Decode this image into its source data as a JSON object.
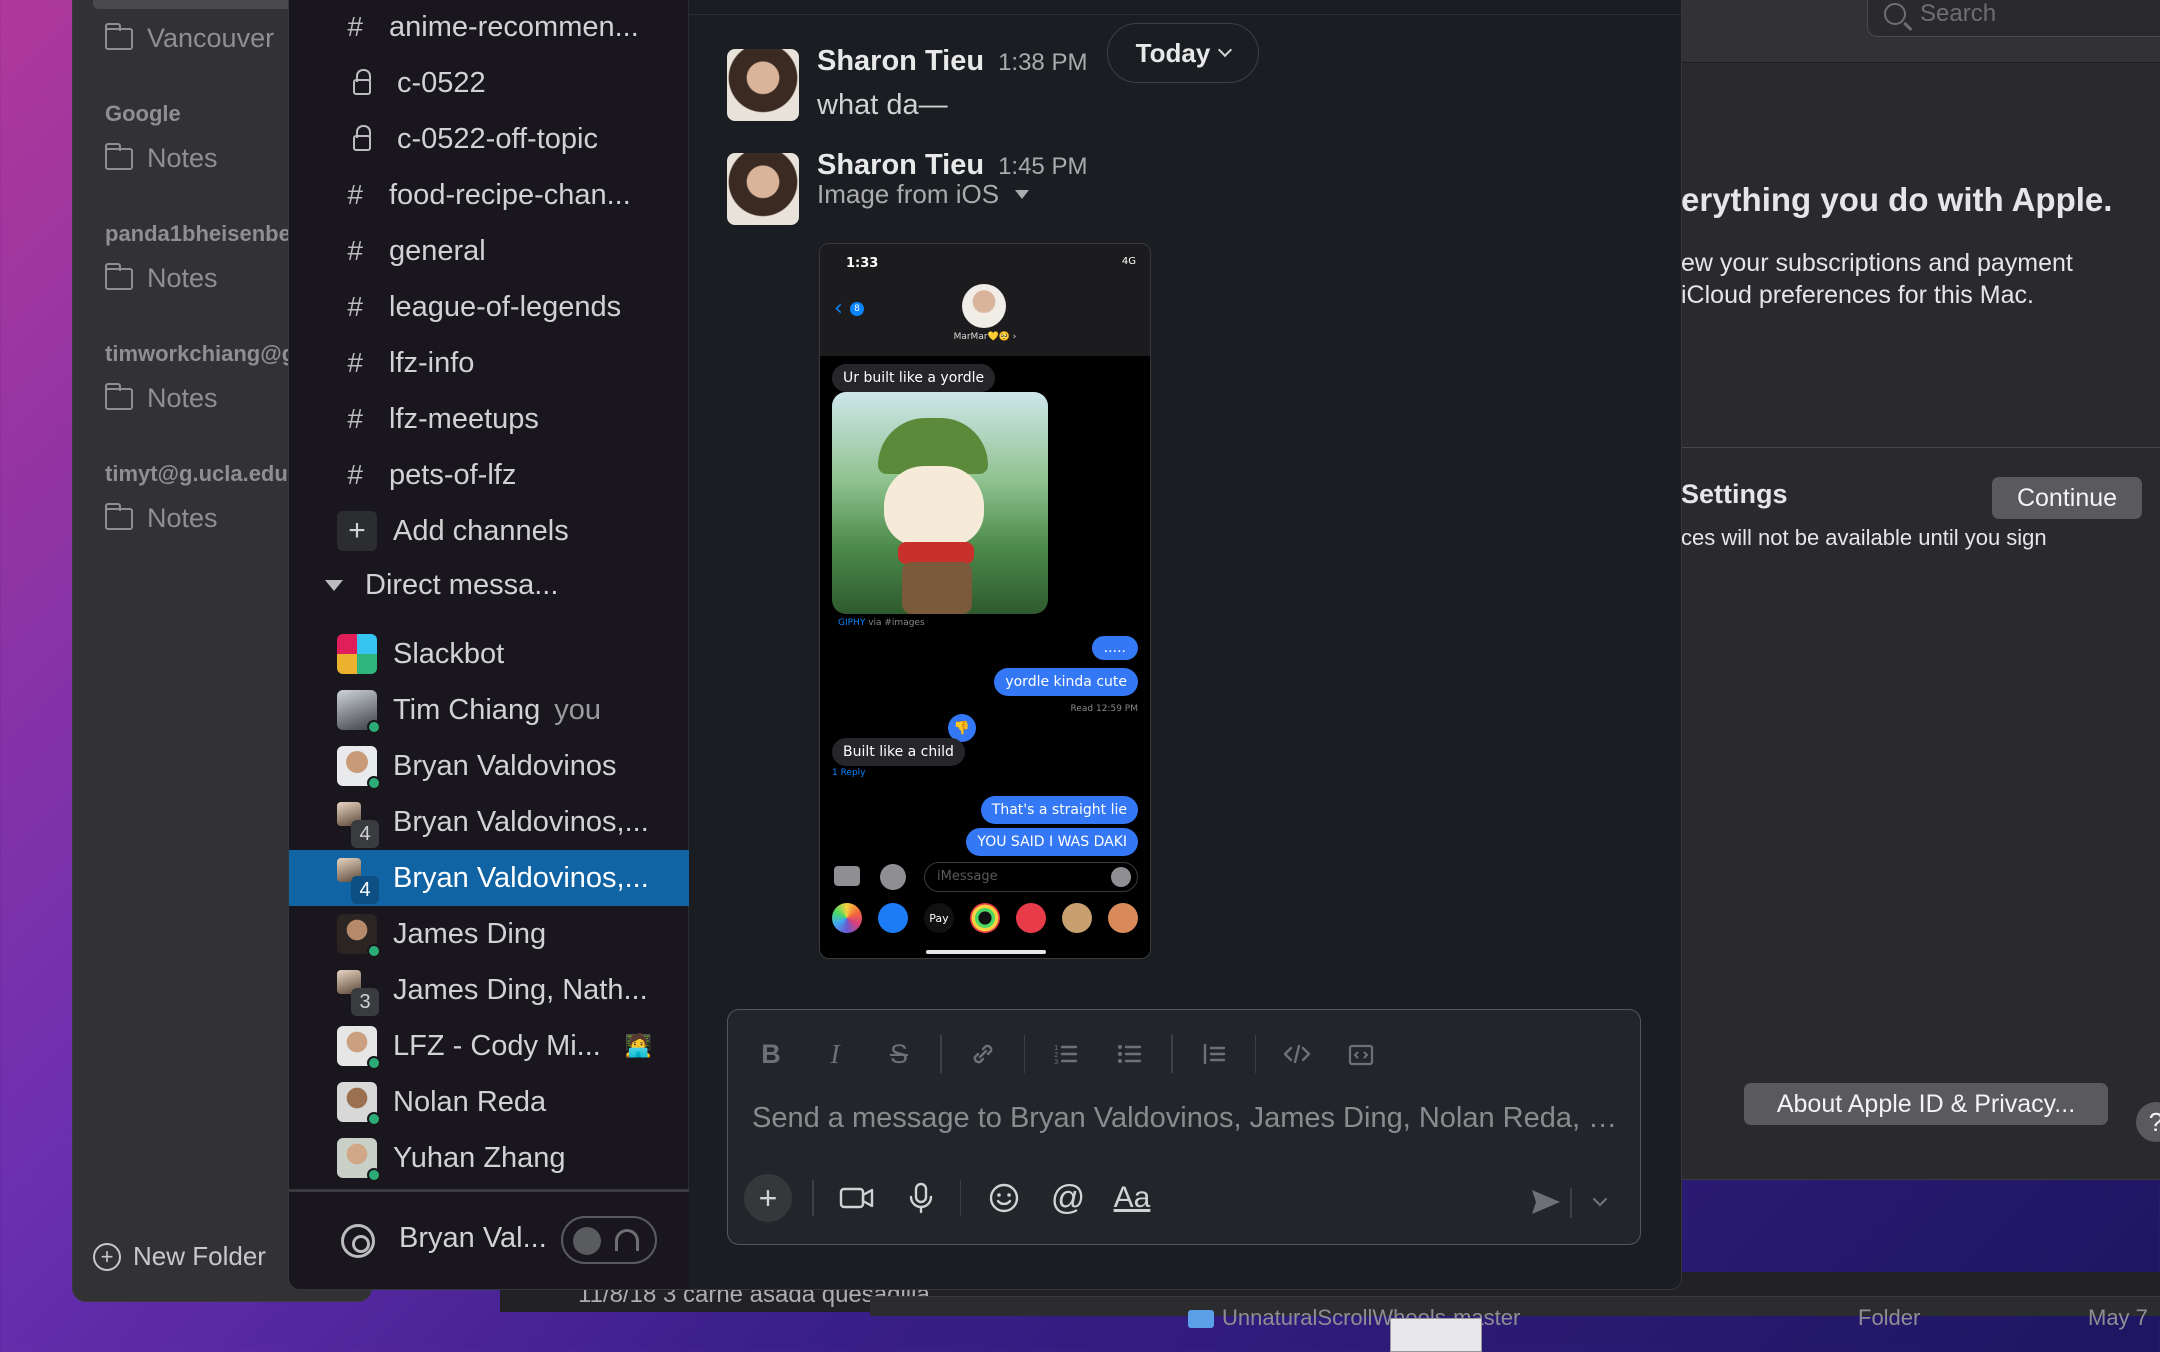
{
  "notes": {
    "accounts": [
      {
        "name": "",
        "folder": "Vancouver"
      },
      {
        "name": "Google",
        "folder": "Notes"
      },
      {
        "name": "panda1bheisenbe",
        "folder": "Notes"
      },
      {
        "name": "timworkchiang@g",
        "folder": "Notes"
      },
      {
        "name": "timyt@g.ucla.edu",
        "folder": "Notes"
      }
    ],
    "new_folder": "New Folder",
    "bottom_note": "11/8/18   3 carne asada quesadilla"
  },
  "finder": {
    "item_name": "UnnaturalScrollWheels-master",
    "item_kind": "Folder",
    "item_date": "May 7"
  },
  "prefs": {
    "search_placeholder": "Search",
    "heading": "erything you do with Apple.",
    "sub_line1": "ew your subscriptions and payment",
    "sub_line2": " iCloud preferences for this Mac.",
    "settings_title": "Settings",
    "settings_sub": "ces will not be available until you sign",
    "continue_label": "Continue",
    "about_label": "About Apple ID & Privacy...",
    "help_label": "?"
  },
  "slack": {
    "channels": [
      {
        "prefix": "#",
        "name": "anime-recommen..."
      },
      {
        "prefix": "lock",
        "name": "c-0522"
      },
      {
        "prefix": "lock",
        "name": "c-0522-off-topic"
      },
      {
        "prefix": "#",
        "name": "food-recipe-chan..."
      },
      {
        "prefix": "#",
        "name": "general"
      },
      {
        "prefix": "#",
        "name": "league-of-legends"
      },
      {
        "prefix": "#",
        "name": "lfz-info"
      },
      {
        "prefix": "#",
        "name": "lfz-meetups"
      },
      {
        "prefix": "#",
        "name": "pets-of-lfz"
      }
    ],
    "add_channels": "Add channels",
    "dm_header": "Direct messa...",
    "dms": [
      {
        "name": "Slackbot",
        "kind": "bot"
      },
      {
        "name": "Tim Chiang",
        "suffix": "you",
        "kind": "user"
      },
      {
        "name": "Bryan Valdovinos",
        "kind": "user"
      },
      {
        "name": "Bryan Valdovinos,...",
        "count": "4",
        "kind": "group"
      },
      {
        "name": "Bryan Valdovinos,...",
        "count": "4",
        "kind": "group",
        "active": true
      },
      {
        "name": "James Ding",
        "kind": "user"
      },
      {
        "name": "James Ding, Nath...",
        "count": "3",
        "kind": "group"
      },
      {
        "name": "LFZ - Cody Mi...",
        "kind": "user",
        "status": "🧑‍💻"
      },
      {
        "name": "Nolan Reda",
        "kind": "user"
      },
      {
        "name": "Yuhan Zhang",
        "kind": "user"
      }
    ],
    "huddle_name": "Bryan Val...",
    "today_label": "Today",
    "messages": [
      {
        "author": "Sharon Tieu",
        "time": "1:38 PM",
        "text": "what da—"
      },
      {
        "author": "Sharon Tieu",
        "time": "1:45 PM",
        "text": "Image from iOS"
      }
    ],
    "composer_placeholder": "Send a message to Bryan Valdovinos, James Ding, Nolan Reda, S..."
  },
  "phone": {
    "time": "1:33",
    "signal": "4G",
    "back_badge": "8",
    "contact": "MarMar💛🥺 ›",
    "bubble1": "Ur built like a yordle",
    "giphy": "GIPHY",
    "giphy_via": " via #images",
    "bubble2": ".....",
    "bubble3": "yordle kinda cute",
    "read": "Read 12:59 PM",
    "bubble4": "Built like a child",
    "reply": "1 Reply",
    "bubble5": "That's a straight lie",
    "bubble6": "YOU SAID I WAS DAKI",
    "imessage_placeholder": "iMessage",
    "apple_pay": "Pay"
  }
}
